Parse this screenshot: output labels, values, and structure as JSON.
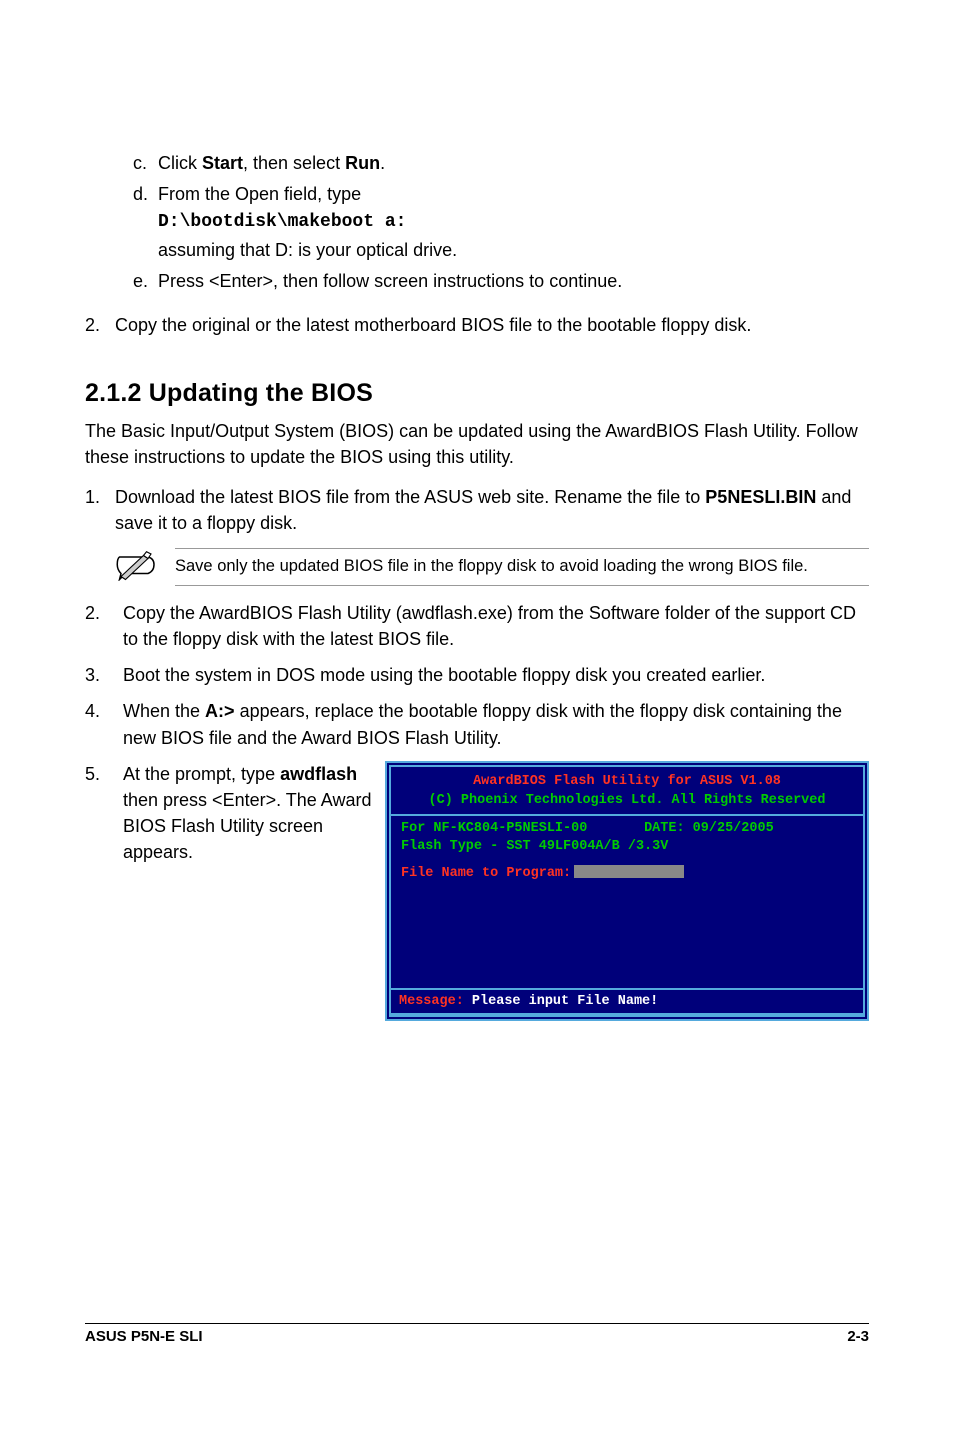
{
  "intro_items": [
    {
      "lbl": "c.",
      "txt_before": "Click ",
      "bold1": "Start",
      "txt_mid": ", then select ",
      "bold2": "Run",
      "txt_after": "."
    },
    {
      "lbl": "d.",
      "txt_before": "From the Open field, type",
      "code": "D:\\bootdisk\\makeboot a:",
      "assume": "assuming that D: is your optical drive."
    },
    {
      "lbl": "e.",
      "txt_before": "Press <Enter>, then follow screen instructions to continue."
    }
  ],
  "intro_step2": {
    "num": "2.",
    "txt": "Copy the original or the latest motherboard BIOS file to the bootable floppy disk."
  },
  "sec_title": "2.1.2   Updating the BIOS",
  "sec_intro": "The Basic Input/Output System (BIOS) can be updated using the AwardBIOS Flash Utility. Follow these instructions to update the BIOS using this utility.",
  "step1": {
    "num": "1.",
    "pre": "Download the latest BIOS file from the ASUS web site. Rename the file to ",
    "fname": "P5NESLI.BIN",
    "post": " and save it to a floppy disk."
  },
  "note": "Save only the updated BIOS file in the floppy disk to avoid loading the wrong BIOS file.",
  "steps_rest": [
    {
      "num": "2.",
      "txt": "Copy the AwardBIOS Flash Utility (awdflash.exe) from the Software folder of the support CD to the floppy disk with the latest BIOS file."
    },
    {
      "num": "3.",
      "txt": "Boot the system in DOS mode using the bootable floppy disk you created earlier."
    }
  ],
  "step4": {
    "num": "4.",
    "pre": "When the ",
    "b": "A:>",
    "post": " appears, replace the bootable floppy disk with the floppy disk containing the new BIOS file and the Award BIOS Flash Utility."
  },
  "step5": {
    "num": "5.",
    "pre": "At the prompt, type ",
    "cmd": "awdflash",
    "post": " then press <Enter>. The Award BIOS Flash Utility screen appears."
  },
  "terminal": {
    "hdr1": "AwardBIOS Flash Utility for ASUS V1.08",
    "hdr2": "(C) Phoenix Technologies Ltd. All Rights Reserved",
    "l1a": "For NF-KC804-P5NESLI-00",
    "l1b": "DATE: 09/25/2005",
    "l2": "Flash Type - SST 49LF004A/B /3.3V",
    "prompt": "File Name to Program:",
    "msg_lbl": "Message:",
    "msg_txt": " Please input File Name!"
  },
  "footer_left": "ASUS P5N-E SLI",
  "footer_right": "2-3"
}
